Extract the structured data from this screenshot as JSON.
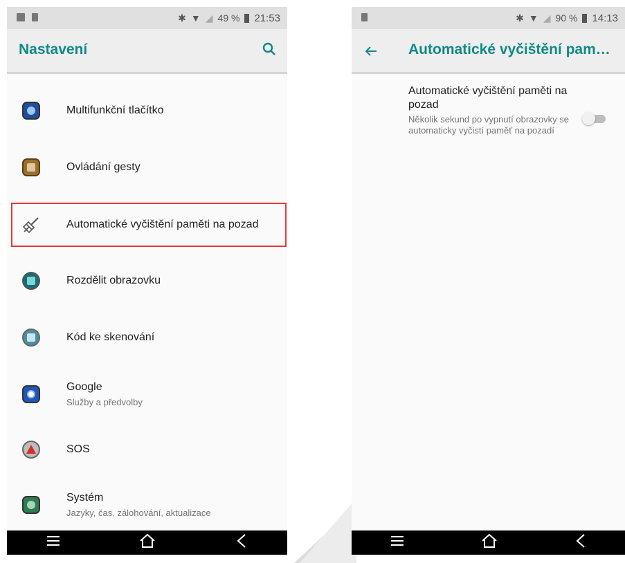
{
  "left_screen": {
    "status": {
      "battery": "49 %",
      "time": "21:53"
    },
    "title": "Nastavení",
    "items": [
      {
        "label": "Multifunkční tlačítko",
        "sub": "",
        "icon": "multifunction-button-icon",
        "color": "#1e63c4"
      },
      {
        "label": "Ovládání gesty",
        "sub": "",
        "icon": "gesture-control-icon",
        "color": "#a57a3a"
      },
      {
        "label": "Automatické vyčištění paměti na pozad",
        "sub": "",
        "icon": "broom-icon",
        "color": "#444444"
      },
      {
        "label": "Rozdělit obrazovku",
        "sub": "",
        "icon": "split-screen-icon",
        "color": "#1a8a8a"
      },
      {
        "label": "Kód ke skenování",
        "sub": "",
        "icon": "scan-code-icon",
        "color": "#4a8ea8"
      },
      {
        "label": "Google",
        "sub": "Služby a předvolby",
        "icon": "google-icon",
        "color": "#2a63c8"
      },
      {
        "label": "SOS",
        "sub": "",
        "icon": "sos-icon",
        "color": "#d32f2f"
      },
      {
        "label": "Systém",
        "sub": "Jazyky, čas, zálohování, aktualizace",
        "icon": "system-icon",
        "color": "#2e8b57"
      }
    ]
  },
  "right_screen": {
    "status": {
      "battery": "90 %",
      "time": "14:13"
    },
    "title": "Automatické vyčištění pam…",
    "setting": {
      "title": "Automatické vyčištění paměti na pozad",
      "summary": "Několik sekund po vypnutí obrazovky se automaticky vyčistí paměť na pozadí",
      "enabled": false
    }
  },
  "colors": {
    "accent": "#108a86",
    "highlight": "#e53935"
  }
}
